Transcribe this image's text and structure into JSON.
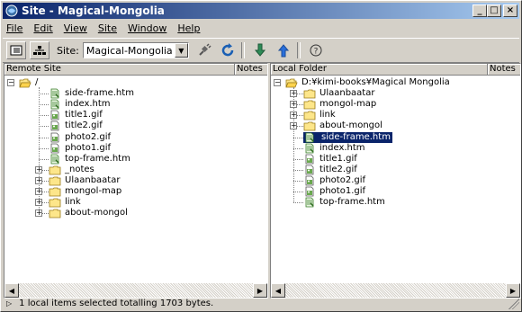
{
  "window": {
    "title": "Site - Magical-Mongolia"
  },
  "menu": [
    "File",
    "Edit",
    "View",
    "Site",
    "Window",
    "Help"
  ],
  "toolbar": {
    "site_label": "Site:",
    "site_value": "Magical-Mongolia"
  },
  "remote": {
    "header": "Remote Site",
    "notes": "Notes",
    "root": "/",
    "items": [
      {
        "label": "side-frame.htm",
        "type": "htm"
      },
      {
        "label": "index.htm",
        "type": "htm"
      },
      {
        "label": "title1.gif",
        "type": "gif"
      },
      {
        "label": "title2.gif",
        "type": "gif"
      },
      {
        "label": "photo2.gif",
        "type": "gif"
      },
      {
        "label": "photo1.gif",
        "type": "gif"
      },
      {
        "label": "top-frame.htm",
        "type": "htm"
      },
      {
        "label": "_notes",
        "type": "folder"
      },
      {
        "label": "Ulaanbaatar",
        "type": "folder"
      },
      {
        "label": "mongol-map",
        "type": "folder"
      },
      {
        "label": "link",
        "type": "folder"
      },
      {
        "label": "about-mongol",
        "type": "folder"
      }
    ]
  },
  "local": {
    "header": "Local Folder",
    "notes": "Notes",
    "root": "D:¥kimi-books¥Magical Mongolia",
    "items": [
      {
        "label": "Ulaanbaatar",
        "type": "folder"
      },
      {
        "label": "mongol-map",
        "type": "folder"
      },
      {
        "label": "link",
        "type": "folder"
      },
      {
        "label": "about-mongol",
        "type": "folder"
      },
      {
        "label": "side-frame.htm",
        "type": "htm",
        "selected": true
      },
      {
        "label": "index.htm",
        "type": "htm"
      },
      {
        "label": "title1.gif",
        "type": "gif"
      },
      {
        "label": "title2.gif",
        "type": "gif"
      },
      {
        "label": "photo2.gif",
        "type": "gif"
      },
      {
        "label": "photo1.gif",
        "type": "gif"
      },
      {
        "label": "top-frame.htm",
        "type": "htm"
      }
    ]
  },
  "status": {
    "text": "1 local items selected totalling 1703 bytes."
  }
}
